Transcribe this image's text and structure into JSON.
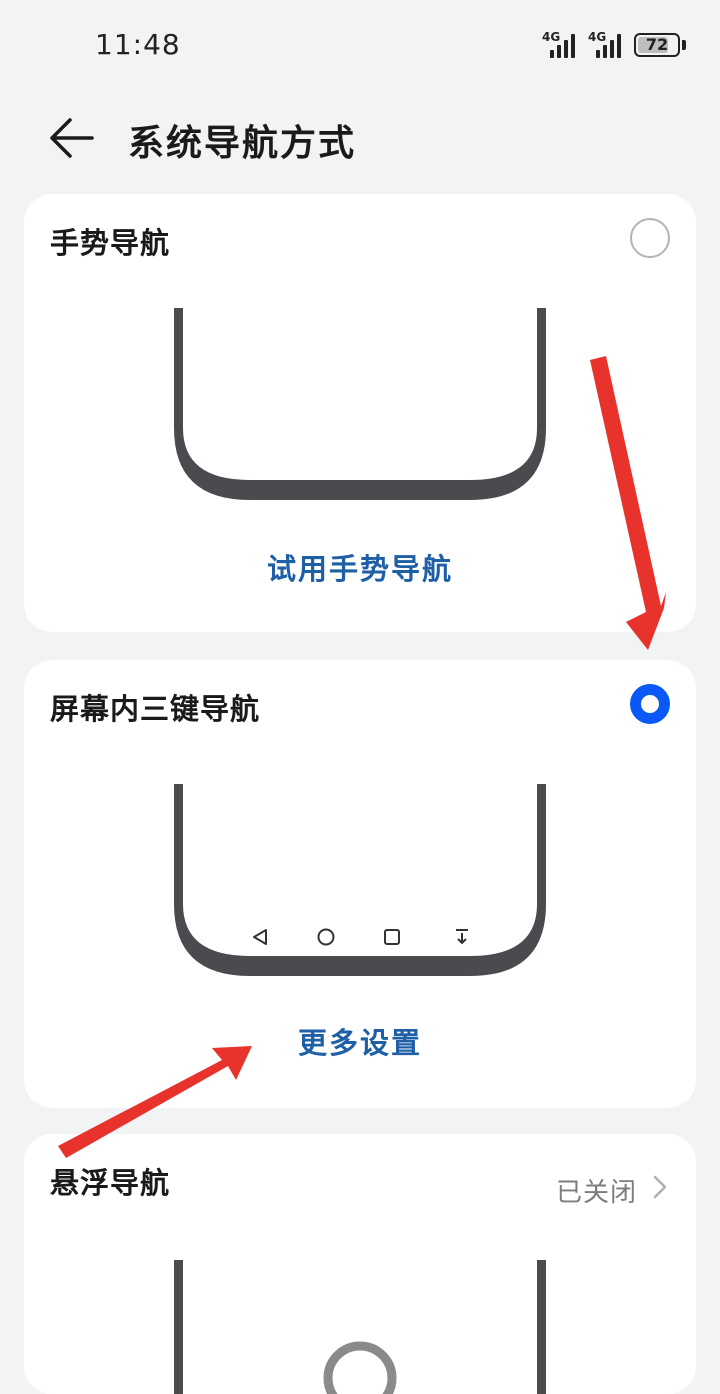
{
  "status_bar": {
    "time": "11:48",
    "signal1": "4G",
    "signal2": "4G",
    "battery": "72"
  },
  "header": {
    "back_icon": "arrow-left-icon",
    "title": "系统导航方式"
  },
  "cards": [
    {
      "title": "手势导航",
      "selected": false,
      "link": "试用手势导航"
    },
    {
      "title": "屏幕内三键导航",
      "selected": true,
      "link": "更多设置",
      "nav_keys": [
        "back-triangle-icon",
        "home-circle-icon",
        "recents-square-icon",
        "hide-bar-icon"
      ]
    },
    {
      "title": "悬浮导航",
      "status": "已关闭"
    }
  ],
  "colors": {
    "accent": "#0a59f7",
    "link": "#1f5fa6",
    "annotation_arrow": "#e8322c",
    "phone_frame": "#4a4b4f"
  }
}
